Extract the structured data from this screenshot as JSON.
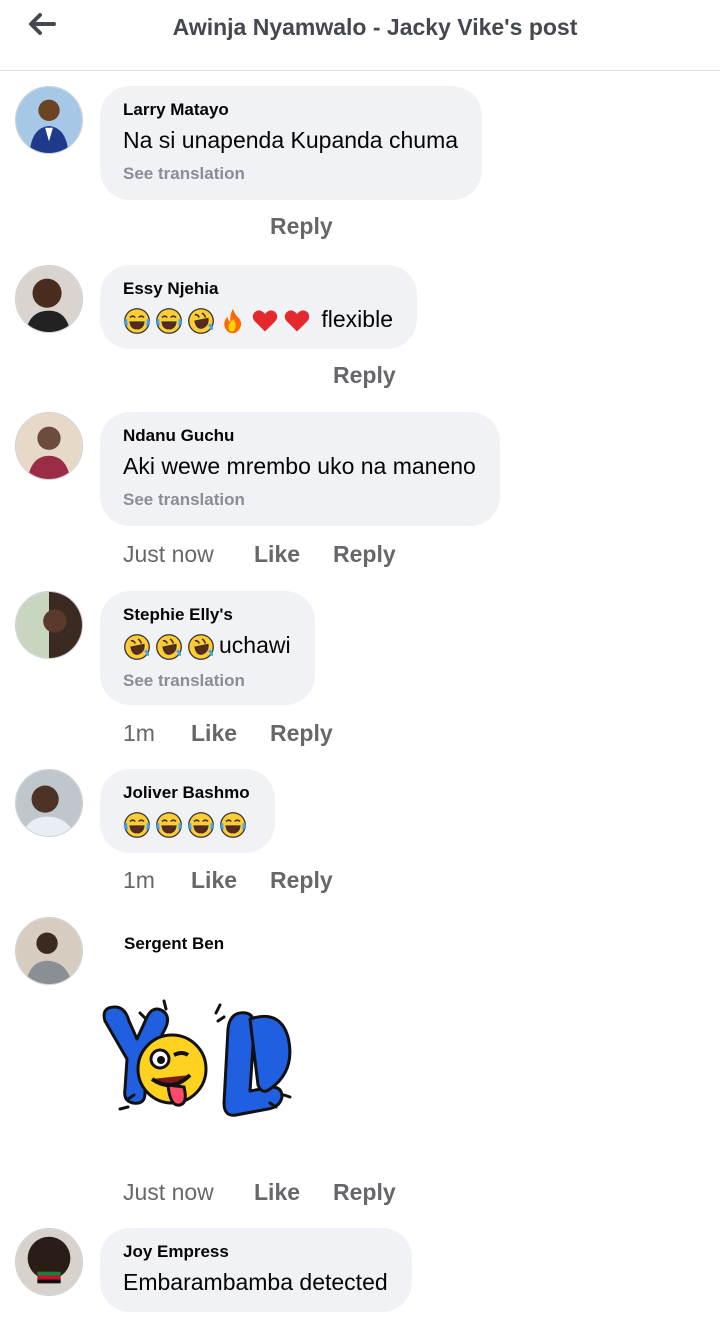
{
  "header": {
    "title": "Awinja Nyamwalo - Jacky Vike's post"
  },
  "comments": [
    {
      "author": "Larry Matayo",
      "text": "Na si unapenda Kupanda chuma",
      "translation": "See translation",
      "reply": "Reply"
    },
    {
      "author": "Essy Njehia",
      "emojis": [
        "laugh-cry",
        "laugh-cry",
        "rofl",
        "fire",
        "heart",
        "heart"
      ],
      "text": "flexible",
      "reply": "Reply"
    },
    {
      "author": "Ndanu Guchu",
      "text": "Aki wewe mrembo uko na maneno",
      "translation": "See translation",
      "time": "Just now",
      "like": "Like",
      "reply": "Reply"
    },
    {
      "author": "Stephie Elly's",
      "emojis": [
        "rofl",
        "rofl",
        "rofl"
      ],
      "text": "uchawi",
      "translation": "See translation",
      "time": "1m",
      "like": "Like",
      "reply": "Reply"
    },
    {
      "author": "Joliver Bashmo",
      "emojis": [
        "laugh-cry",
        "laugh-cry",
        "laugh-cry",
        "laugh-cry"
      ],
      "time": "1m",
      "like": "Like",
      "reply": "Reply"
    },
    {
      "author": "Sergent Ben",
      "sticker": "yolo-sticker",
      "time": "Just now",
      "like": "Like",
      "reply": "Reply"
    },
    {
      "author": "Joy Empress",
      "text": "Embarambamba detected"
    }
  ],
  "colors": {
    "bubble": "#f0f2f5",
    "meta": "#65676b",
    "translation": "#8a8d91",
    "sticker_blue": "#1f5fe0",
    "sticker_yellow": "#ffd21f"
  }
}
